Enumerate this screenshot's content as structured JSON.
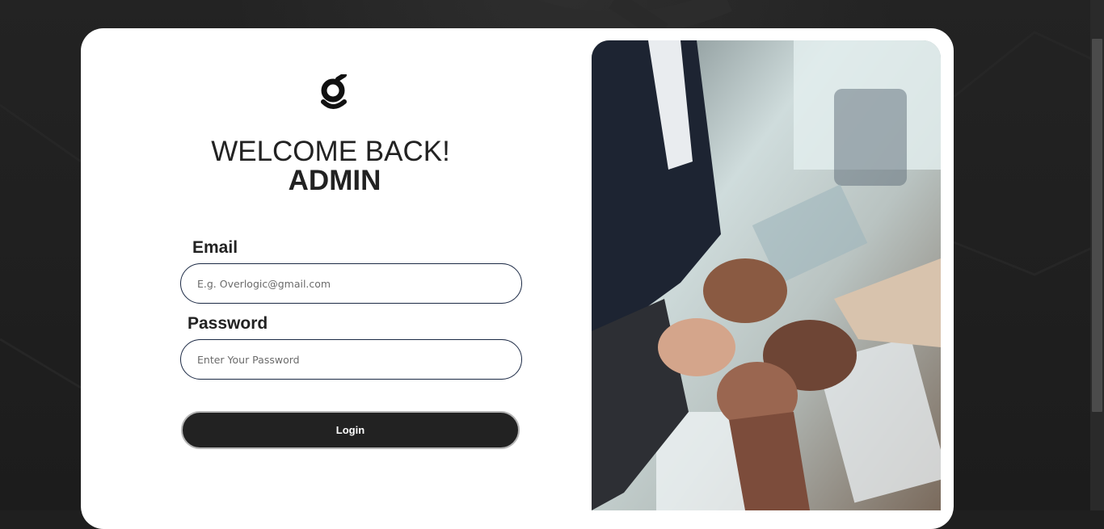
{
  "login": {
    "logo_alt": "g",
    "welcome": "WELCOME BACK!",
    "role": "ADMIN",
    "email_label": "Email",
    "email_placeholder": "E.g. Overlogic@gmail.com",
    "password_label": "Password",
    "password_placeholder": "Enter Your Password",
    "login_button": "Login"
  },
  "hero": {
    "image_subject": "team-hands-stacked-photo"
  },
  "colors": {
    "background": "#1f1f1f",
    "card": "#ffffff",
    "button": "#222222",
    "input_border": "#1c2a45"
  }
}
